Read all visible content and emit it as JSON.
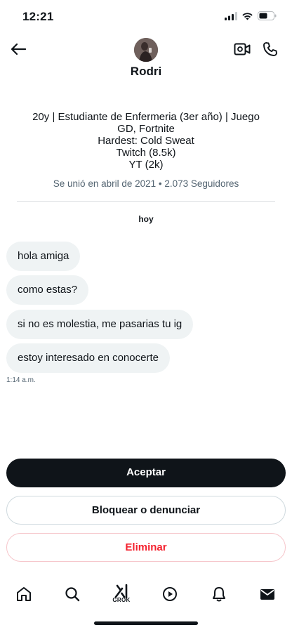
{
  "status_bar": {
    "time": "12:21"
  },
  "header": {
    "name": "Rodri"
  },
  "profile": {
    "bio_lines": [
      "20y | Estudiante de Enfermeria (3er año) | Juego",
      "GD, Fortnite",
      "Hardest: Cold Sweat",
      "Twitch (8.5k)",
      "YT (2k)"
    ],
    "meta": "Se unió en abril de 2021 • 2.073 Seguidores"
  },
  "conversation": {
    "day_label": "hoy",
    "messages": [
      {
        "text": "hola amiga"
      },
      {
        "text": "como estas?"
      },
      {
        "text": "si no es molestia, me pasarias tu ig"
      },
      {
        "text": "estoy interesado en conocerte"
      }
    ],
    "timestamp": "1:14 a.m."
  },
  "actions": {
    "accept": "Aceptar",
    "block": "Bloquear o denunciar",
    "delete": "Eliminar"
  },
  "tabbar": {
    "items": [
      "home-icon",
      "search-icon",
      "grok-icon",
      "video-icon",
      "notifications-icon",
      "messages-icon"
    ],
    "grok_label": "GROK"
  },
  "colors": {
    "text": "#0f1419",
    "secondary": "#536471",
    "bubble": "#eff3f4",
    "accept_bg": "#0f1419",
    "delete_text": "#f4212e"
  }
}
